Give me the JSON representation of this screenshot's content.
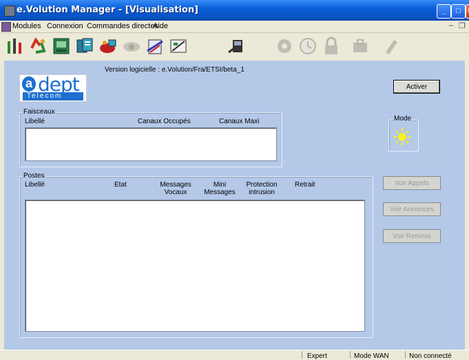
{
  "window": {
    "title": "e.Volution Manager - [Visualisation]"
  },
  "menu": {
    "items": [
      "Modules",
      "Connexion",
      "Commandes directes",
      "Aide"
    ]
  },
  "toolbar": {
    "icons": [
      "antenna-icon",
      "recycle-icon",
      "terminal-icon",
      "cards-icon",
      "lock-paint-icon",
      "eye-icon",
      "notepad-icon",
      "config-icon",
      "phone-icon",
      "gear-icon",
      "clock-icon",
      "padlock-icon",
      "case-icon",
      "pen-icon"
    ]
  },
  "header": {
    "version": "Version logicielle : e.Volution/Fra/ETSI/beta_1"
  },
  "buttons": {
    "activer": "Activer",
    "voir_appels": "Voir Appels",
    "voir_annonces": "Voir Annonces",
    "voir_renvois": "Voir Renvois"
  },
  "mode": {
    "label": "Mode"
  },
  "faisceaux": {
    "title": "Faisceaux",
    "columns": [
      "Libellé",
      "Canaux Occupés",
      "Canaux Maxi"
    ]
  },
  "postes": {
    "title": "Postes",
    "columns": [
      "Libellé",
      "Etat",
      "Messages Vocaux",
      "Mini Messages",
      "Protection intrusion",
      "Retrait"
    ]
  },
  "status": {
    "expert": "Expert",
    "mode_wan": "Mode WAN",
    "connection": "Non connecté"
  }
}
